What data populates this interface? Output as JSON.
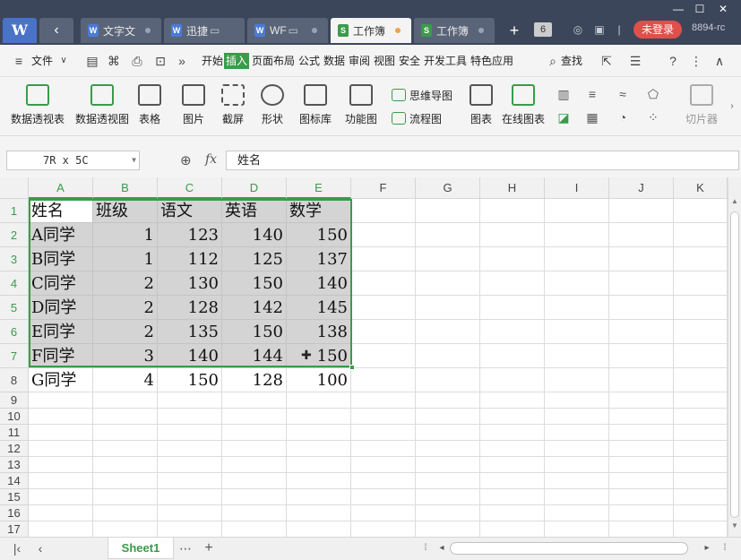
{
  "titlebar": {
    "app_logo": "W",
    "tabs": [
      {
        "label": "文字文",
        "icon": "W",
        "icon_color": "#4a7bd8",
        "active": false
      },
      {
        "label": "迅捷",
        "icon": "W",
        "icon_color": "#4a7bd8",
        "active": false
      },
      {
        "label": "WF",
        "icon": "W",
        "icon_color": "#4a7bd8",
        "active": false
      },
      {
        "label": "工作簿",
        "icon": "S",
        "icon_color": "#3a9b4a",
        "active": true
      },
      {
        "label": "工作簿",
        "icon": "S",
        "icon_color": "#3a9b4a",
        "active": false
      }
    ],
    "tab_count": "6",
    "login_label": "未登录",
    "user_id": "8894-rc"
  },
  "menubar": {
    "file_label": "文件",
    "items": [
      "开始",
      "插入",
      "页面布局",
      "公式",
      "数据",
      "审阅",
      "视图",
      "安全",
      "开发工具",
      "特色应用"
    ],
    "active_index": 1,
    "search_label": "查找"
  },
  "ribbon": {
    "pivot_table": "数据透视表",
    "pivot_chart": "数据透视图",
    "table": "表格",
    "picture": "图片",
    "screenshot": "截屏",
    "shape": "形状",
    "icon_library": "图标库",
    "function_chart": "功能图",
    "mind_map": "思维导图",
    "flowchart": "流程图",
    "chart": "图表",
    "online_chart": "在线图表",
    "slicer": "切片器"
  },
  "formulabar": {
    "name_box": "7R x 5C",
    "fx_label": "fx",
    "formula": "姓名"
  },
  "sheet": {
    "columns": [
      "A",
      "B",
      "C",
      "D",
      "E",
      "F",
      "G",
      "H",
      "I",
      "J",
      "K"
    ],
    "rows": [
      "1",
      "2",
      "3",
      "4",
      "5",
      "6",
      "7",
      "8",
      "9",
      "10",
      "11",
      "12",
      "13",
      "14",
      "15",
      "16",
      "17"
    ],
    "data": [
      [
        "姓名",
        "班级",
        "语文",
        "英语",
        "数学"
      ],
      [
        "A同学",
        "1",
        "123",
        "140",
        "150"
      ],
      [
        "B同学",
        "1",
        "112",
        "125",
        "137"
      ],
      [
        "C同学",
        "2",
        "130",
        "150",
        "140"
      ],
      [
        "D同学",
        "2",
        "128",
        "142",
        "145"
      ],
      [
        "E同学",
        "2",
        "135",
        "150",
        "138"
      ],
      [
        "F同学",
        "3",
        "140",
        "144",
        "150"
      ],
      [
        "G同学",
        "4",
        "150",
        "128",
        "100"
      ]
    ]
  },
  "sheetbar": {
    "sheet_name": "Sheet1"
  },
  "colors": {
    "accent": "#3a9b4a",
    "titlebar": "#3c465a",
    "login": "#e0504a"
  }
}
